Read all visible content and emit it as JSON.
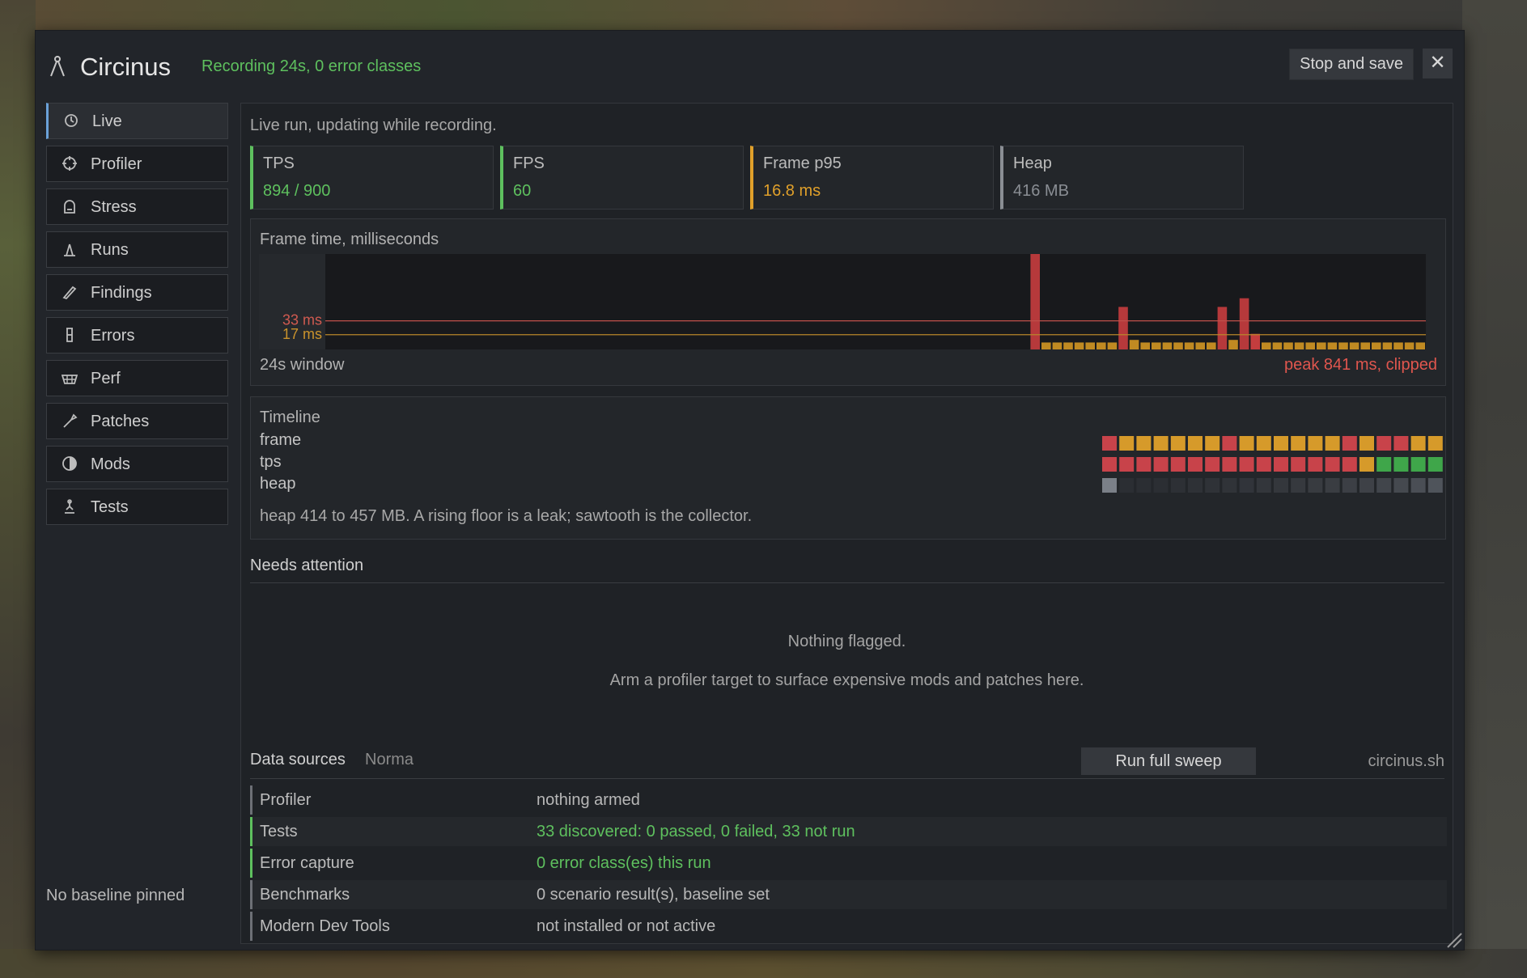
{
  "window": {
    "title": "Circinus",
    "recording_status": "Recording 24s, 0 error classes",
    "stop_label": "Stop and save",
    "close_label": "✕"
  },
  "sidebar": {
    "items": [
      {
        "label": "Live",
        "icon": "clock-icon",
        "active": true
      },
      {
        "label": "Profiler",
        "icon": "crosshair-icon"
      },
      {
        "label": "Stress",
        "icon": "bell-icon"
      },
      {
        "label": "Runs",
        "icon": "runner-icon"
      },
      {
        "label": "Findings",
        "icon": "pen-icon"
      },
      {
        "label": "Errors",
        "icon": "beaker-icon"
      },
      {
        "label": "Perf",
        "icon": "basket-icon"
      },
      {
        "label": "Patches",
        "icon": "wrench-icon"
      },
      {
        "label": "Mods",
        "icon": "half-circle-icon"
      },
      {
        "label": "Tests",
        "icon": "flask-icon"
      }
    ],
    "baseline_status": "No baseline pinned"
  },
  "live": {
    "description": "Live run, updating while recording.",
    "stats": [
      {
        "name": "TPS",
        "value": "894 / 900",
        "color": "#5ec05e"
      },
      {
        "name": "FPS",
        "value": "60",
        "color": "#5ec05e"
      },
      {
        "name": "Frame p95",
        "value": "16.8 ms",
        "color": "#e0a02a"
      },
      {
        "name": "Heap",
        "value": "416 MB",
        "color": "#8a8e94"
      }
    ],
    "frame_chart": {
      "title": "Frame time, milliseconds",
      "window_label": "24s window",
      "peak_label": "peak 841 ms, clipped",
      "threshold_high_label": "33 ms",
      "threshold_low_label": "17 ms"
    },
    "timeline": {
      "title": "Timeline",
      "rows": [
        "frame",
        "tps",
        "heap"
      ],
      "note": "heap 414 to 457 MB. A rising floor is a leak; sawtooth is the collector."
    },
    "attention": {
      "title": "Needs attention",
      "empty": "Nothing flagged.",
      "hint": "Arm a profiler target to surface expensive mods and patches here."
    },
    "data_sources": {
      "title": "Data sources",
      "mode": "Norma",
      "sweep_label": "Run full sweep",
      "site": "circinus.sh",
      "rows": [
        {
          "key": "Profiler",
          "value": "nothing armed",
          "ok": false
        },
        {
          "key": "Tests",
          "value": "33 discovered: 0 passed, 0 failed, 33 not run",
          "ok": true
        },
        {
          "key": "Error capture",
          "value": "0 error class(es) this run",
          "ok": true
        },
        {
          "key": "Benchmarks",
          "value": "0 scenario result(s), baseline set",
          "ok": false
        },
        {
          "key": "Modern Dev Tools",
          "value": "not installed or not active",
          "ok": false
        }
      ]
    }
  },
  "chart_data": {
    "type": "bar",
    "title": "Frame time, milliseconds",
    "xlabel": "24s window",
    "ylabel": "",
    "thresholds": [
      33,
      17
    ],
    "peak_ms": 841,
    "values_ms": [
      0,
      0,
      0,
      0,
      0,
      0,
      0,
      0,
      0,
      0,
      0,
      0,
      0,
      0,
      0,
      0,
      0,
      0,
      0,
      0,
      0,
      0,
      0,
      0,
      0,
      0,
      0,
      0,
      0,
      0,
      0,
      0,
      0,
      0,
      0,
      0,
      0,
      0,
      0,
      0,
      0,
      0,
      0,
      0,
      0,
      0,
      0,
      0,
      0,
      0,
      0,
      0,
      0,
      0,
      0,
      0,
      0,
      0,
      0,
      0,
      0,
      0,
      0,
      0,
      841,
      8,
      8,
      8,
      8,
      8,
      8,
      8,
      49,
      11,
      8,
      8,
      8,
      8,
      8,
      8,
      8,
      49,
      11,
      59,
      18,
      8,
      8,
      8,
      8,
      8,
      8,
      8,
      8,
      8,
      8,
      8,
      8,
      8,
      8,
      8
    ]
  }
}
